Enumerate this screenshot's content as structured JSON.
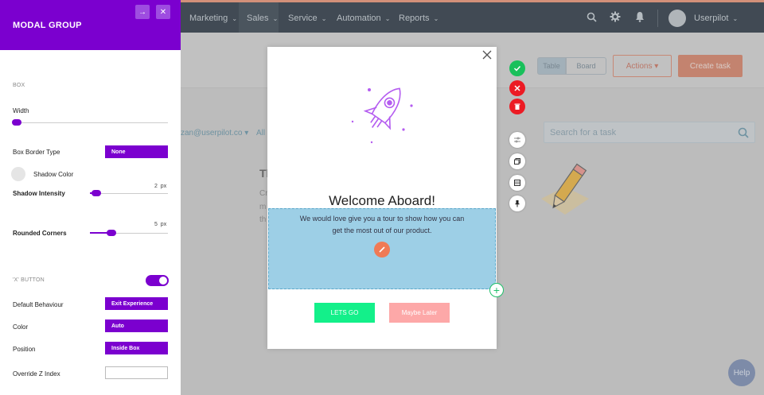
{
  "app": {
    "nav": {
      "items": [
        {
          "label": "Marketing",
          "chevron": "⌄"
        },
        {
          "label": "Sales",
          "chevron": "⌄"
        },
        {
          "label": "Service",
          "chevron": "⌄"
        },
        {
          "label": "Automation",
          "chevron": "⌄"
        },
        {
          "label": "Reports",
          "chevron": "⌄"
        }
      ],
      "user_name": "Userpilot",
      "icons": [
        "search-icon",
        "gear-icon",
        "bell-icon"
      ]
    },
    "view_toggle": {
      "table_label": "Table",
      "board_label": "Board"
    },
    "actions_label": "Actions ▾",
    "create_task_label": "Create task",
    "email_filter": "zan@userpilot.co ▾",
    "all_filter": "All",
    "bg_heading": "Tl",
    "bg_lines": [
      "Cr",
      "m",
      "th"
    ],
    "search_placeholder": "Search for a task",
    "help_label": "Help"
  },
  "panel": {
    "title": "MODAL GROUP",
    "section_box": "BOX",
    "width_label": "Width",
    "width_level": 0.03,
    "box_border_type_label": "Box Border Type",
    "box_border_type_value": "None",
    "shadow_color_label": "Shadow Color",
    "shadow_intensity_label": "Shadow Intensity",
    "shadow_intensity_value": "2",
    "shadow_intensity_unit": "px",
    "rounded_corners_label": "Rounded Corners",
    "rounded_corners_value": "5",
    "rounded_corners_unit": "px",
    "section_x_button": "'X' BUTTON",
    "x_button_enabled": true,
    "default_behaviour_label": "Default Behaviour",
    "default_behaviour_value": "Exit Experience",
    "color_label": "Color",
    "color_value": "Auto",
    "position_label": "Position",
    "position_value": "Inside Box",
    "override_z_index_label": "Override Z Index",
    "override_z_index_value": ""
  },
  "modal": {
    "title": "Welcome Aboard!",
    "body_line1": "We would love give you a tour to show how you can",
    "body_line2": "get the most out of our product.",
    "primary_button": "LETS GO",
    "secondary_button": "Maybe Later"
  },
  "colors": {
    "brand_purple": "#7b00cf",
    "go_green": "#13f08a",
    "later_pink": "#fda8a8",
    "confirm_green": "#19c05b",
    "danger_red": "#ec1b24",
    "selection_blue": "#9dcfe6"
  }
}
